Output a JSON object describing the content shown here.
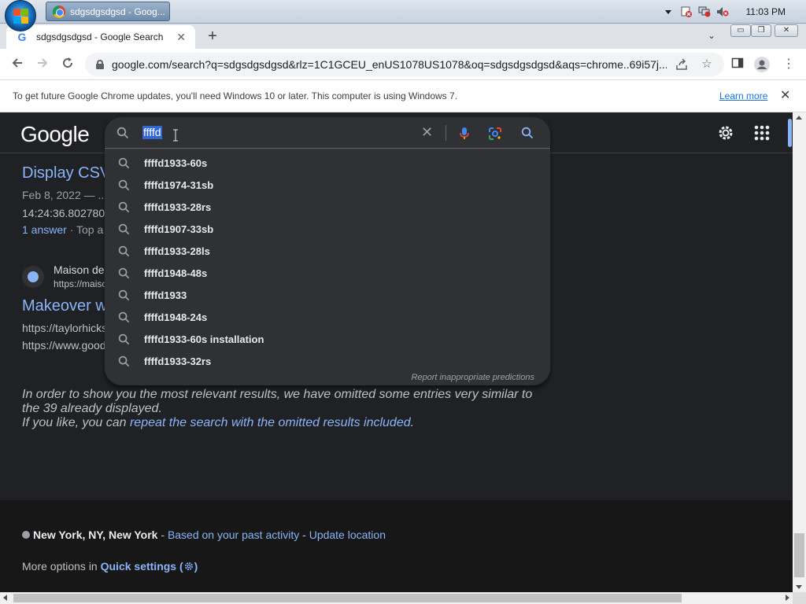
{
  "taskbar": {
    "task_button_label": "sdgsdgsdgsd - Goog...",
    "clock": "11:03 PM"
  },
  "tabs": [
    {
      "title": "sdgsdgsdgsd - Google Search",
      "favicon": "G"
    }
  ],
  "toolbar": {
    "url": "google.com/search?q=sdgsdgsdgsd&rlz=1C1GCEU_enUS1078US1078&oq=sdgsdgsdgsd&aqs=chrome..69i57j..."
  },
  "infobar": {
    "message": "To get future Google Chrome updates, you'll need Windows 10 or later. This computer is using Windows 7.",
    "learn_more": "Learn more"
  },
  "header": {
    "logo": "Google"
  },
  "search": {
    "query": "ffffd",
    "suggestions": [
      "ffffd1933-60s",
      "ffffd1974-31sb",
      "ffffd1933-28rs",
      "ffffd1907-33sb",
      "ffffd1933-28ls",
      "ffffd1948-48s",
      "ffffd1933",
      "ffffd1948-24s",
      "ffffd1933-60s installation",
      "ffffd1933-32rs"
    ],
    "report_text": "Report inappropriate predictions"
  },
  "results": {
    "r1_title": "Display CSV",
    "r1_date": "Feb 8, 2022 — ...",
    "r1_snippet": "14:24:36.802780",
    "r1_answer": "1 answer",
    "r1_top": " · Top a",
    "r2_site": "Maison de",
    "r2_url": "https://maiso",
    "r2_title": "Makeover w",
    "r2_line1": "https://taylorhicks",
    "r2_line2": "https://www.good"
  },
  "omitted": {
    "line1": "In order to show you the most relevant results, we have omitted some entries very similar to the 39 already displayed.",
    "line2_prefix": "If you like, you can ",
    "line2_link": "repeat the search with the omitted results included",
    "line2_suffix": "."
  },
  "footer": {
    "location": "New York, NY, New York",
    "sep1": " - ",
    "past_activity": "Based on your past activity",
    "sep2": " - ",
    "update_location": "Update location",
    "more_options": "More options in ",
    "quick_settings": "Quick settings ("
  },
  "colors": {
    "page_bg": "#202124",
    "link": "#8ab4f8",
    "highlight": "#3367d6"
  }
}
